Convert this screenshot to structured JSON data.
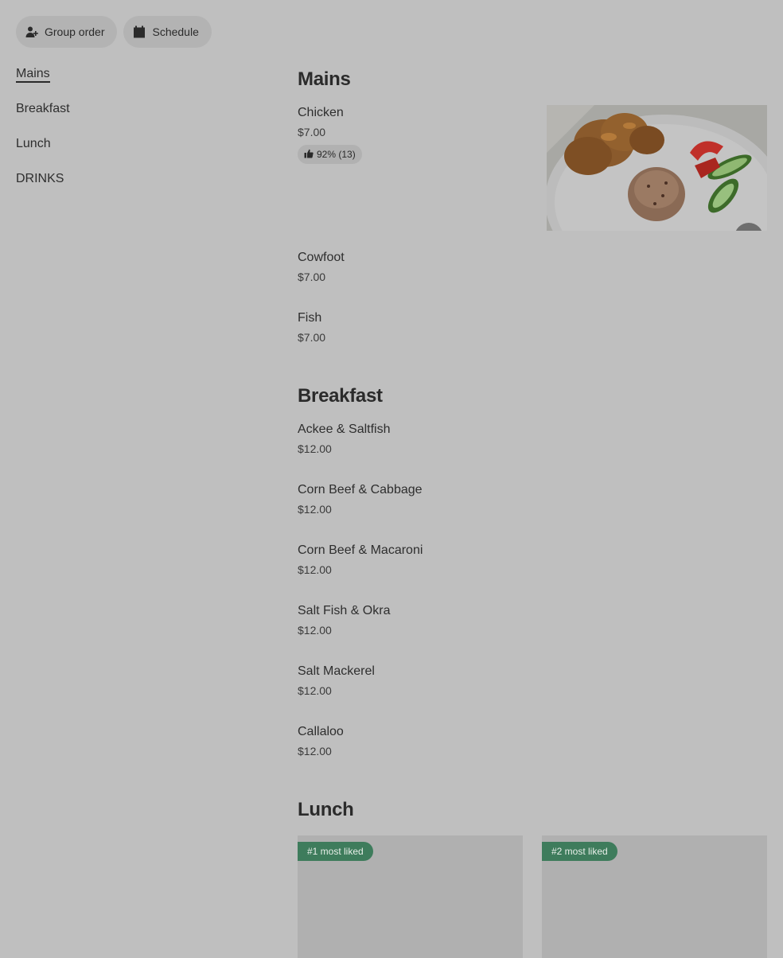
{
  "toolbar": {
    "group_order": "Group order",
    "schedule": "Schedule"
  },
  "sidebar": {
    "items": [
      {
        "label": "Mains",
        "active": true
      },
      {
        "label": "Breakfast"
      },
      {
        "label": "Lunch"
      },
      {
        "label": "DRINKS"
      }
    ]
  },
  "sections": {
    "mains": {
      "title": "Mains",
      "items": [
        {
          "name": "Chicken",
          "price": "$7.00",
          "rating": "92% (13)"
        },
        {
          "name": "Cowfoot",
          "price": "$7.00"
        },
        {
          "name": "Fish",
          "price": "$7.00"
        }
      ]
    },
    "breakfast": {
      "title": "Breakfast",
      "items": [
        {
          "name": "Ackee & Saltfish",
          "price": "$12.00"
        },
        {
          "name": "Corn Beef & Cabbage",
          "price": "$12.00"
        },
        {
          "name": "Corn Beef & Macaroni",
          "price": "$12.00"
        },
        {
          "name": "Salt Fish & Okra",
          "price": "$12.00"
        },
        {
          "name": "Salt Mackerel",
          "price": "$12.00"
        },
        {
          "name": "Callaloo",
          "price": "$12.00"
        }
      ]
    },
    "lunch": {
      "title": "Lunch",
      "cards": [
        {
          "badge": "#1 most liked"
        },
        {
          "badge": "#2 most liked"
        }
      ]
    }
  },
  "colors": {
    "page_overlay": "#bfbfbf",
    "badge_green": "#3e7c5c"
  },
  "icons": {
    "group_order": "add-person-icon",
    "schedule": "calendar-icon",
    "rating": "thumbs-up-icon"
  }
}
